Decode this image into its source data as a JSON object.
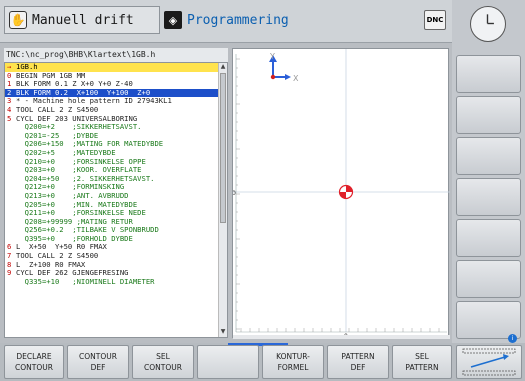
{
  "header": {
    "mode_manual": "Manuell drift",
    "mode_programming": "Programmering",
    "dnc_label": "DNC"
  },
  "program": {
    "path": "TNC:\\nc_prog\\BHB\\Klartext\\1GB.h",
    "lines": [
      {
        "n": "→",
        "code": "1GB.h",
        "style": "file"
      },
      {
        "n": "0",
        "code": "BEGIN PGM 1GB MM",
        "style": "prog"
      },
      {
        "n": "1",
        "code": "BLK FORM 0.1 Z X+0 Y+0 Z-40",
        "style": "prog"
      },
      {
        "n": "2",
        "code": "BLK FORM 0.2  X+100  Y+100  Z+0",
        "style": "sel"
      },
      {
        "n": "3",
        "code": "* - Machine hole pattern ID 27943KL1",
        "style": "prog"
      },
      {
        "n": "4",
        "code": "TOOL CALL 2 Z S4500",
        "style": "prog"
      },
      {
        "n": "5",
        "code": "CYCL DEF 203 UNIVERSALBORING",
        "style": "prog"
      },
      {
        "n": "",
        "code": "  Q200=+2    ;SIKKERHETSAVST.",
        "style": "param"
      },
      {
        "n": "",
        "code": "  Q201=-25   ;DYBDE",
        "style": "param"
      },
      {
        "n": "",
        "code": "  Q206=+150  ;MATING FOR MATEDYBDE",
        "style": "param"
      },
      {
        "n": "",
        "code": "  Q202=+5    ;MATEDYBDE",
        "style": "param"
      },
      {
        "n": "",
        "code": "  Q210=+0    ;FORSINKELSE OPPE",
        "style": "param"
      },
      {
        "n": "",
        "code": "  Q203=+0    ;KOOR. OVERFLATE",
        "style": "param"
      },
      {
        "n": "",
        "code": "  Q204=+50   ;2. SIKKERHETSAVST.",
        "style": "param"
      },
      {
        "n": "",
        "code": "  Q212=+0    ;FORMINSKING",
        "style": "param"
      },
      {
        "n": "",
        "code": "  Q213=+0    ;ANT. AVBRUDD",
        "style": "param"
      },
      {
        "n": "",
        "code": "  Q205=+0    ;MIN. MATEDYBDE",
        "style": "param"
      },
      {
        "n": "",
        "code": "  Q211=+0    ;FORSINKELSE NEDE",
        "style": "param"
      },
      {
        "n": "",
        "code": "  Q208=+99999 ;MATING RETUR",
        "style": "param"
      },
      {
        "n": "",
        "code": "  Q256=+0.2  ;TILBAKE V SPONBRUDD",
        "style": "param"
      },
      {
        "n": "",
        "code": "  Q395=+0    ;FORHOLD DYBDE",
        "style": "param"
      },
      {
        "n": "6",
        "code": "L  X+50  Y+50 R0 FMAX",
        "style": "prog"
      },
      {
        "n": "7",
        "code": "TOOL CALL 2 Z S4500",
        "style": "prog"
      },
      {
        "n": "8",
        "code": "L  Z+100 R0 FMAX",
        "style": "prog"
      },
      {
        "n": "9",
        "code": "CYCL DEF 262 GJENGEFRESING",
        "style": "prog"
      },
      {
        "n": "",
        "code": "  Q335=+10   ;NIOMINELL DIAMETER",
        "style": "param"
      }
    ]
  },
  "graphics": {
    "axis_y": "Y",
    "axis_x": "X",
    "ruler_zero": "0"
  },
  "softkeys": {
    "k1": [
      "DECLARE",
      "CONTOUR"
    ],
    "k2": [
      "CONTOUR",
      "DEF"
    ],
    "k3": [
      "SEL",
      "CONTOUR"
    ],
    "k4": [
      "",
      ""
    ],
    "k5": [
      "KONTUR-",
      "FORMEL"
    ],
    "k6": [
      "PATTERN",
      "DEF"
    ],
    "k7": [
      "SEL",
      "PATTERN"
    ]
  },
  "colors": {
    "selection": "#1d4fc9",
    "file_highlight": "#ffe34d",
    "comment": "#1b7a1b",
    "line_number": "#c00000",
    "marker": "#e0202a"
  }
}
